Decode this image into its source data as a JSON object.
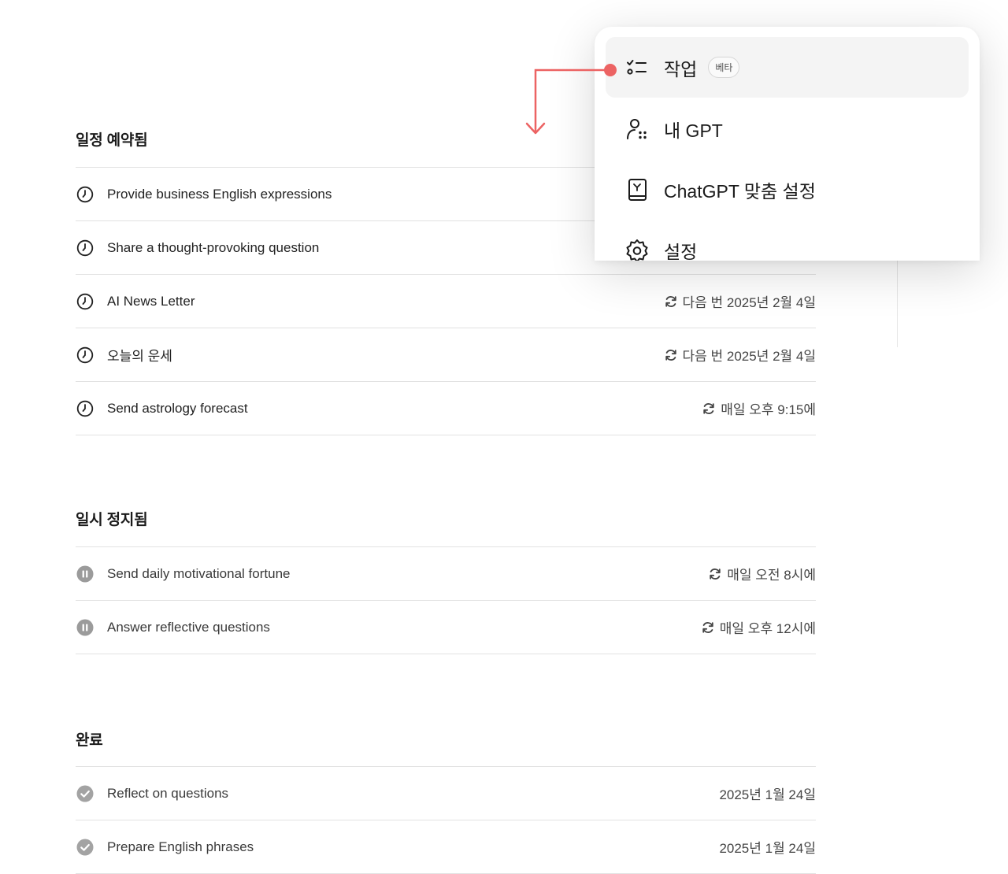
{
  "sections": {
    "scheduled": {
      "title": "일정 예약됨",
      "items": [
        {
          "title": "Provide business English expressions",
          "meta": ""
        },
        {
          "title": "Share a thought-provoking question",
          "meta": ""
        },
        {
          "title": "AI News Letter",
          "meta": "다음 번 2025년 2월 4일"
        },
        {
          "title": "오늘의 운세",
          "meta": "다음 번 2025년 2월 4일"
        },
        {
          "title": "Send astrology forecast",
          "meta": "매일 오후 9:15에"
        }
      ]
    },
    "paused": {
      "title": "일시 정지됨",
      "items": [
        {
          "title": "Send daily motivational fortune",
          "meta": "매일 오전 8시에"
        },
        {
          "title": "Answer reflective questions",
          "meta": "매일 오후 12시에"
        }
      ]
    },
    "completed": {
      "title": "완료",
      "items": [
        {
          "title": "Reflect on questions",
          "meta": "2025년 1월 24일"
        },
        {
          "title": "Prepare English phrases",
          "meta": "2025년 1월 24일"
        }
      ]
    }
  },
  "menu": {
    "items": [
      {
        "label": "작업",
        "icon": "task-checklist-icon",
        "badge": "베타"
      },
      {
        "label": "내 GPT",
        "icon": "my-gpt-icon"
      },
      {
        "label": "ChatGPT 맞춤 설정",
        "icon": "customize-book-icon"
      },
      {
        "label": "설정",
        "icon": "gear-icon"
      }
    ]
  },
  "colors": {
    "annotation": "#ec6363",
    "paused_icon": "#9b9b9b",
    "done_icon": "#a3a3a3",
    "active_menu_bg": "#f4f4f4"
  }
}
